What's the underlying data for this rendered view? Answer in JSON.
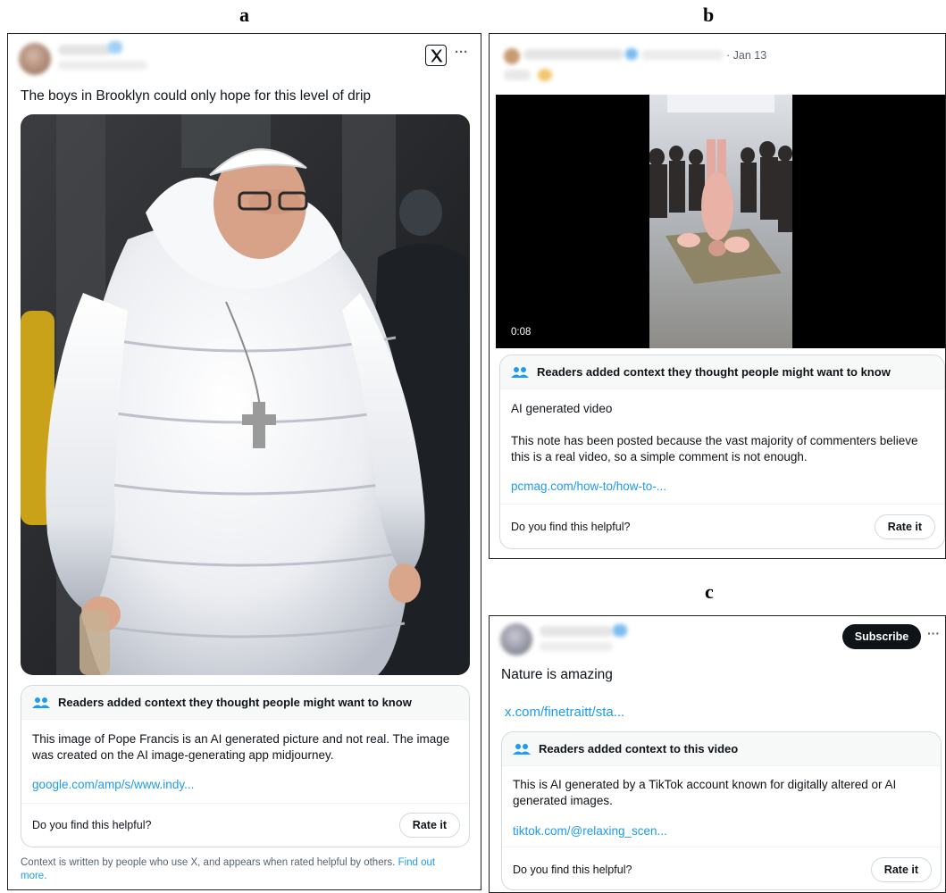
{
  "panels": {
    "a": {
      "letter": "a",
      "tweet_text": "The boys in Brooklyn could only hope for this level of drip",
      "note": {
        "header": "Readers added context they thought people might want to know",
        "body": "This image of Pope Francis is an AI generated picture and not real. The image was created on the AI image-generating app midjourney.",
        "link": "google.com/amp/s/www.indy...",
        "helpful_prompt": "Do you find this helpful?",
        "rate_label": "Rate it"
      },
      "footer_text": "Context is written by people who use X, and appears when rated helpful by others.",
      "footer_link": "Find out more.",
      "more_glyph": "···"
    },
    "b": {
      "letter": "b",
      "date": "· Jan 13",
      "video_time": "0:08",
      "note": {
        "header": "Readers added context they thought people might want to know",
        "summary": "AI generated video",
        "body": "This note has been posted because the vast majority of commenters believe this is a real video, so a simple comment is not enough.",
        "link": "pcmag.com/how-to/how-to-...",
        "helpful_prompt": "Do you find this helpful?",
        "rate_label": "Rate it"
      }
    },
    "c": {
      "letter": "c",
      "subscribe_label": "Subscribe",
      "more_glyph": "···",
      "tweet_text": "Nature is amazing",
      "tweet_link": "x.com/finetraitt/sta...",
      "note": {
        "header": "Readers added context to this video",
        "body": "This is AI generated by a TikTok account known for digitally altered or AI generated images.",
        "link": "tiktok.com/@relaxing_scen...",
        "helpful_prompt": "Do you find this helpful?",
        "rate_label": "Rate it"
      }
    }
  },
  "colors": {
    "link": "#1d9bf0",
    "verified": "#1d9bf0",
    "note_header_bg": "#f7f9f9",
    "subscribe_bg": "#0f1419"
  },
  "icons": [
    "x-logo-icon",
    "more-icon",
    "people-icon",
    "verified-badge-icon"
  ]
}
